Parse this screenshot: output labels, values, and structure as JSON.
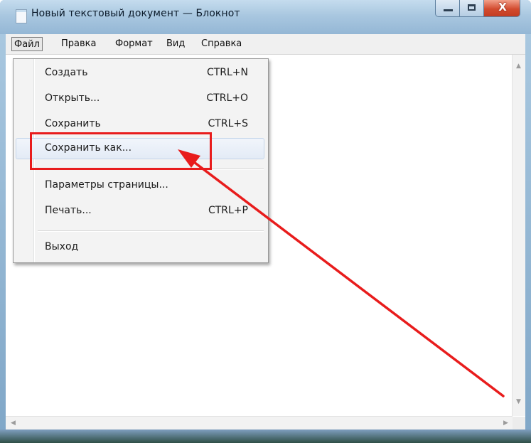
{
  "window": {
    "title": "Новый текстовый документ — Блокнот",
    "close_glyph": "X"
  },
  "menubar": {
    "items": [
      "Файл",
      "Правка",
      "Формат",
      "Вид",
      "Справка"
    ]
  },
  "file_menu": {
    "items": [
      {
        "label": "Создать",
        "shortcut": "CTRL+N"
      },
      {
        "label": "Открыть...",
        "shortcut": "CTRL+O"
      },
      {
        "label": "Сохранить",
        "shortcut": "CTRL+S"
      },
      {
        "label": "Сохранить как...",
        "shortcut": ""
      },
      {
        "label": "Параметры страницы...",
        "shortcut": ""
      },
      {
        "label": "Печать...",
        "shortcut": "CTRL+P"
      },
      {
        "label": "Выход",
        "shortcut": ""
      }
    ],
    "highlighted_item": "Сохранить как..."
  },
  "annotation": {
    "color": "#e81c1c",
    "icons": [
      "highlight-box",
      "arrow-pointer"
    ]
  },
  "editor": {
    "content": ""
  }
}
